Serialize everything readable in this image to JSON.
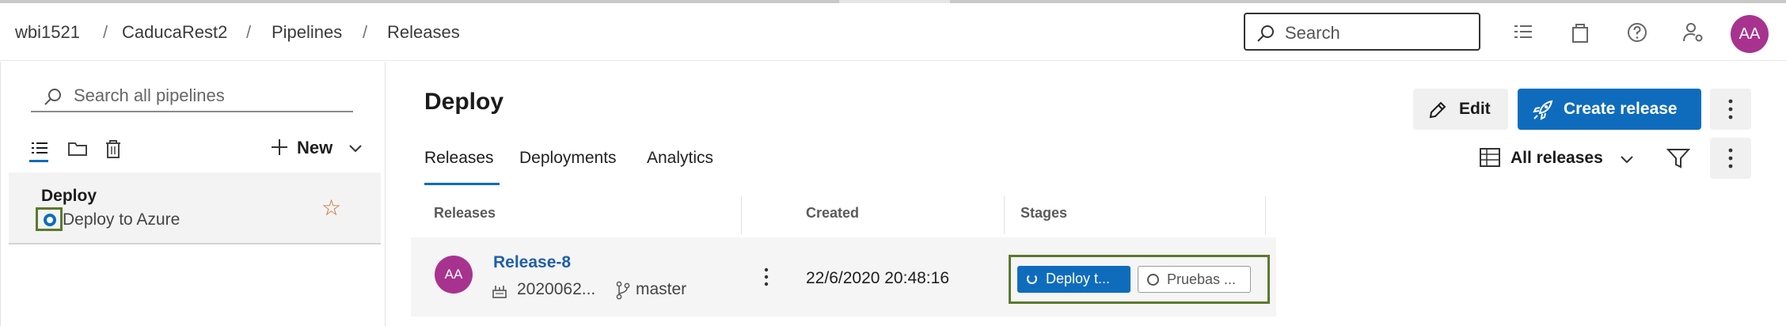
{
  "breadcrumb": [
    "wbi1521",
    "CaducaRest2",
    "Pipelines",
    "Releases"
  ],
  "header": {
    "search_placeholder": "Search",
    "icons": [
      "list-settings-icon",
      "shopping-bag-icon",
      "help-icon",
      "user-settings-icon"
    ],
    "avatar_initials": "AA"
  },
  "sidebar": {
    "search_placeholder": "Search all pipelines",
    "tools": [
      "list-view-icon",
      "folder-icon",
      "trash-icon"
    ],
    "new_label": "New",
    "pipelines": [
      {
        "title": "Deploy",
        "subtitle": "Deploy to Azure",
        "favorite": false
      }
    ]
  },
  "main": {
    "title": "Deploy",
    "tabs": [
      {
        "label": "Releases",
        "active": true
      },
      {
        "label": "Deployments",
        "active": false
      },
      {
        "label": "Analytics",
        "active": false
      }
    ],
    "edit_label": "Edit",
    "create_label": "Create release",
    "view_label": "All releases"
  },
  "table": {
    "headers": [
      "Releases",
      "Created",
      "Stages"
    ],
    "rows": [
      {
        "avatar": "AA",
        "name": "Release-8",
        "build": "2020062...",
        "branch": "master",
        "created": "22/6/2020 20:48:16",
        "stages": [
          {
            "label": "Deploy t...",
            "status": "in-progress"
          },
          {
            "label": "Pruebas ...",
            "status": "not-started"
          }
        ]
      }
    ]
  },
  "colors": {
    "accent": "#0f6cbd",
    "avatar": "#a8338f",
    "highlight": "#5a7a2e",
    "star": "#c9692b"
  }
}
